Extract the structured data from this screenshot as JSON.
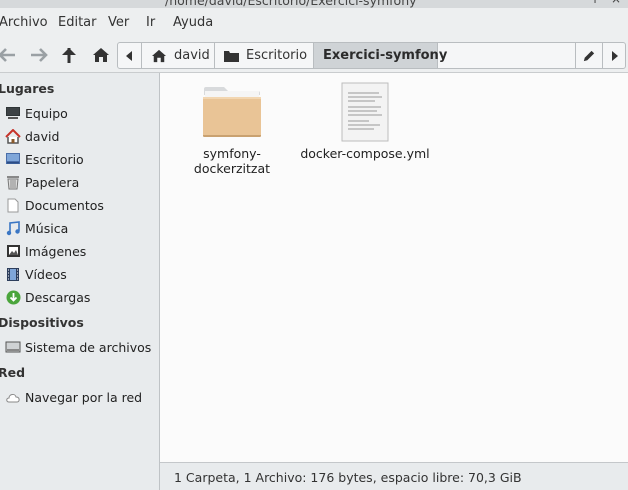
{
  "window": {
    "title": "/home/david/Escritorio/Exercici-symfony"
  },
  "menubar": {
    "items": [
      "Archivo",
      "Editar",
      "Ver",
      "Ir",
      "Ayuda"
    ]
  },
  "toolbar": {
    "buttons": [
      "back-icon",
      "forward-icon",
      "up-icon",
      "home-icon"
    ]
  },
  "pathbar": {
    "crumbs": [
      {
        "label": "david",
        "icon": "home-icon"
      },
      {
        "label": "Escritorio",
        "icon": "folder-icon"
      },
      {
        "label": "Exercici-symfony",
        "active": true
      }
    ]
  },
  "sidebar": {
    "sections": [
      {
        "title": "Lugares",
        "items": [
          {
            "label": "Equipo",
            "icon": "computer-icon"
          },
          {
            "label": "david",
            "icon": "home-icon"
          },
          {
            "label": "Escritorio",
            "icon": "desktop-icon"
          },
          {
            "label": "Papelera",
            "icon": "trash-icon"
          },
          {
            "label": "Documentos",
            "icon": "document-icon"
          },
          {
            "label": "Música",
            "icon": "music-icon"
          },
          {
            "label": "Imágenes",
            "icon": "image-icon"
          },
          {
            "label": "Vídeos",
            "icon": "video-icon"
          },
          {
            "label": "Descargas",
            "icon": "download-icon"
          }
        ]
      },
      {
        "title": "Dispositivos",
        "items": [
          {
            "label": "Sistema de archivos",
            "icon": "harddisk-icon"
          }
        ]
      },
      {
        "title": "Red",
        "items": [
          {
            "label": "Navegar por la red",
            "icon": "network-icon"
          }
        ]
      }
    ]
  },
  "files": [
    {
      "name": "symfony-dockerzitzat",
      "type": "folder"
    },
    {
      "name": "docker-compose.yml",
      "type": "text-file"
    }
  ],
  "statusbar": {
    "text": "1 Carpeta, 1 Archivo: 176 bytes, espacio libre: 70,3 GiB"
  },
  "colors": {
    "folder": "#e9c496",
    "sidebar_bg": "#e8ebed",
    "active_crumb": "#cfd3d6"
  }
}
